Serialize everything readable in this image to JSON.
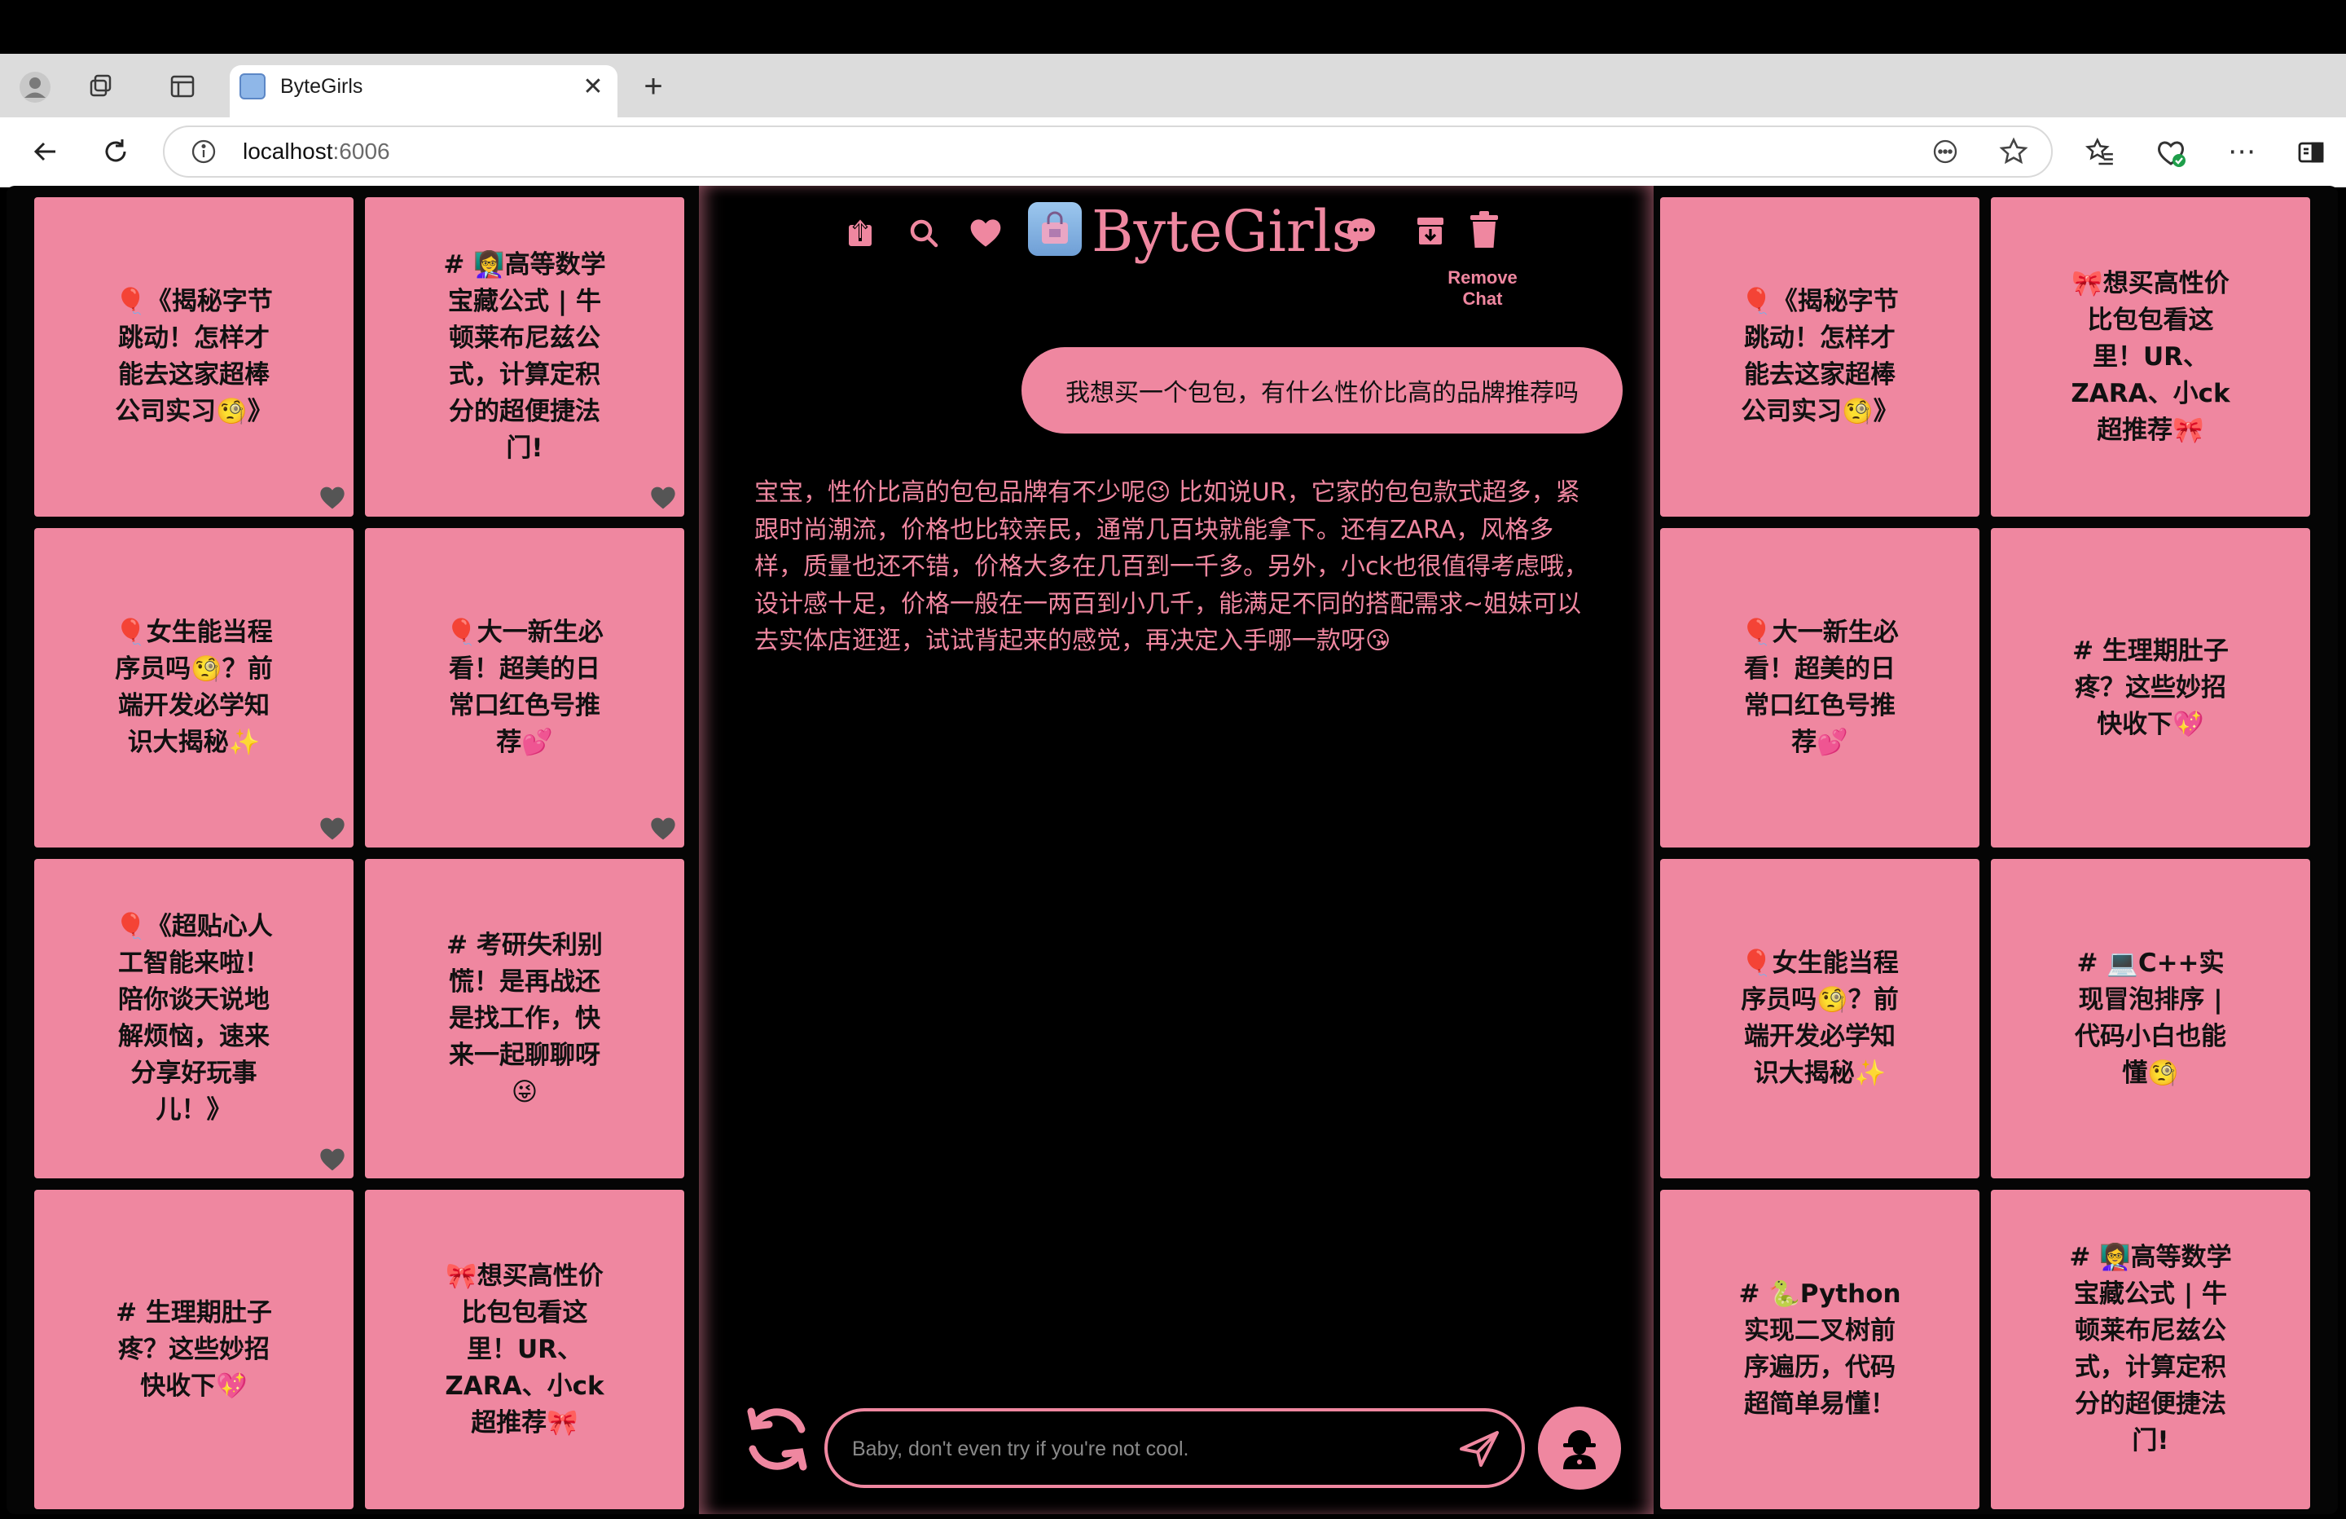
{
  "browser": {
    "tab_title": "ByteGirls",
    "url_host": "localhost",
    "url_port": ":6006",
    "icons": [
      "profile-icon",
      "collections-icon",
      "tab-actions-icon",
      "back-icon",
      "reload-icon",
      "info-icon",
      "reading-mode-icon",
      "favorite-star-icon",
      "favorites-icon",
      "browser-essentials-icon",
      "more-icon",
      "sidebar-icon"
    ]
  },
  "app": {
    "brand": "ByteGirls",
    "remove_chat_label": "Remove Chat",
    "accent_color": "#ef87a0",
    "background_color": "#000000",
    "header_icons": [
      "share-icon",
      "search-icon",
      "heart-icon",
      "chat-bubble-icon",
      "archive-icon",
      "trash-icon"
    ]
  },
  "left_cards": [
    {
      "text": "🎈《揭秘字节跳动！怎样才能去这家超棒公司实习🧐》",
      "liked": true
    },
    {
      "text": "# 👩‍🏫高等数学宝藏公式 | 牛顿莱布尼兹公式，计算定积分的超便捷法门!",
      "liked": true
    },
    {
      "text": "🎈女生能当程序员吗🧐？前端开发必学知识大揭秘✨",
      "liked": true
    },
    {
      "text": "🎈大一新生必看！超美的日常口红色号推荐💕",
      "liked": true
    },
    {
      "text": "🎈《超贴心人工智能来啦！陪你谈天说地解烦恼，速来分享好玩事儿！》",
      "liked": true
    },
    {
      "text": "# 考研失利别慌！是再战还是找工作，快来一起聊聊呀😜",
      "liked": false
    },
    {
      "text": "# 生理期肚子疼？这些妙招快收下💖",
      "liked": false
    },
    {
      "text": "🎀想买高性价比包包看这里！UR、ZARA、小ck超推荐🎀",
      "liked": false
    }
  ],
  "right_cards": [
    {
      "text": "🎈《揭秘字节跳动！怎样才能去这家超棒公司实习🧐》"
    },
    {
      "text": "🎀想买高性价比包包看这里！UR、ZARA、小ck超推荐🎀"
    },
    {
      "text": "🎈大一新生必看！超美的日常口红色号推荐💕"
    },
    {
      "text": "# 生理期肚子疼？这些妙招快收下💖"
    },
    {
      "text": "🎈女生能当程序员吗🧐？前端开发必学知识大揭秘✨"
    },
    {
      "text": "# 💻C++实现冒泡排序 | 代码小白也能懂🧐"
    },
    {
      "text": "# 🐍Python实现二叉树前序遍历，代码超简单易懂！"
    },
    {
      "text": "# 👩‍🏫高等数学宝藏公式 | 牛顿莱布尼兹公式，计算定积分的超便捷法门!"
    }
  ],
  "chat": {
    "user_message": "我想买一个包包，有什么性价比高的品牌推荐吗",
    "assistant_message": "宝宝，性价比高的包包品牌有不少呢😉 比如说UR，它家的包包款式超多，紧跟时尚潮流，价格也比较亲民，通常几百块就能拿下。还有ZARA，风格多样，质量也还不错，价格大多在几百到一千多。另外，小ck也很值得考虑哦，设计感十足，价格一般在一两百到小几千，能满足不同的搭配需求~姐妹可以去实体店逛逛，试试背起来的感觉，再决定入手哪一款呀😘",
    "input_placeholder": "Baby, don't even try if you're not cool.",
    "input_value": ""
  }
}
